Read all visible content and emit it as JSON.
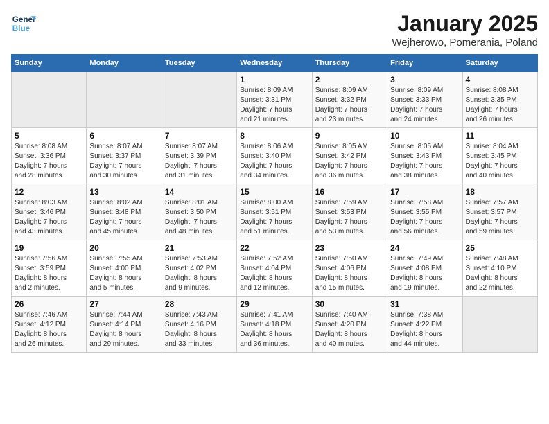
{
  "header": {
    "logo_line1": "General",
    "logo_line2": "Blue",
    "month": "January 2025",
    "location": "Wejherowo, Pomerania, Poland"
  },
  "weekdays": [
    "Sunday",
    "Monday",
    "Tuesday",
    "Wednesday",
    "Thursday",
    "Friday",
    "Saturday"
  ],
  "weeks": [
    [
      {
        "day": "",
        "info": ""
      },
      {
        "day": "",
        "info": ""
      },
      {
        "day": "",
        "info": ""
      },
      {
        "day": "1",
        "info": "Sunrise: 8:09 AM\nSunset: 3:31 PM\nDaylight: 7 hours\nand 21 minutes."
      },
      {
        "day": "2",
        "info": "Sunrise: 8:09 AM\nSunset: 3:32 PM\nDaylight: 7 hours\nand 23 minutes."
      },
      {
        "day": "3",
        "info": "Sunrise: 8:09 AM\nSunset: 3:33 PM\nDaylight: 7 hours\nand 24 minutes."
      },
      {
        "day": "4",
        "info": "Sunrise: 8:08 AM\nSunset: 3:35 PM\nDaylight: 7 hours\nand 26 minutes."
      }
    ],
    [
      {
        "day": "5",
        "info": "Sunrise: 8:08 AM\nSunset: 3:36 PM\nDaylight: 7 hours\nand 28 minutes."
      },
      {
        "day": "6",
        "info": "Sunrise: 8:07 AM\nSunset: 3:37 PM\nDaylight: 7 hours\nand 30 minutes."
      },
      {
        "day": "7",
        "info": "Sunrise: 8:07 AM\nSunset: 3:39 PM\nDaylight: 7 hours\nand 31 minutes."
      },
      {
        "day": "8",
        "info": "Sunrise: 8:06 AM\nSunset: 3:40 PM\nDaylight: 7 hours\nand 34 minutes."
      },
      {
        "day": "9",
        "info": "Sunrise: 8:05 AM\nSunset: 3:42 PM\nDaylight: 7 hours\nand 36 minutes."
      },
      {
        "day": "10",
        "info": "Sunrise: 8:05 AM\nSunset: 3:43 PM\nDaylight: 7 hours\nand 38 minutes."
      },
      {
        "day": "11",
        "info": "Sunrise: 8:04 AM\nSunset: 3:45 PM\nDaylight: 7 hours\nand 40 minutes."
      }
    ],
    [
      {
        "day": "12",
        "info": "Sunrise: 8:03 AM\nSunset: 3:46 PM\nDaylight: 7 hours\nand 43 minutes."
      },
      {
        "day": "13",
        "info": "Sunrise: 8:02 AM\nSunset: 3:48 PM\nDaylight: 7 hours\nand 45 minutes."
      },
      {
        "day": "14",
        "info": "Sunrise: 8:01 AM\nSunset: 3:50 PM\nDaylight: 7 hours\nand 48 minutes."
      },
      {
        "day": "15",
        "info": "Sunrise: 8:00 AM\nSunset: 3:51 PM\nDaylight: 7 hours\nand 51 minutes."
      },
      {
        "day": "16",
        "info": "Sunrise: 7:59 AM\nSunset: 3:53 PM\nDaylight: 7 hours\nand 53 minutes."
      },
      {
        "day": "17",
        "info": "Sunrise: 7:58 AM\nSunset: 3:55 PM\nDaylight: 7 hours\nand 56 minutes."
      },
      {
        "day": "18",
        "info": "Sunrise: 7:57 AM\nSunset: 3:57 PM\nDaylight: 7 hours\nand 59 minutes."
      }
    ],
    [
      {
        "day": "19",
        "info": "Sunrise: 7:56 AM\nSunset: 3:59 PM\nDaylight: 8 hours\nand 2 minutes."
      },
      {
        "day": "20",
        "info": "Sunrise: 7:55 AM\nSunset: 4:00 PM\nDaylight: 8 hours\nand 5 minutes."
      },
      {
        "day": "21",
        "info": "Sunrise: 7:53 AM\nSunset: 4:02 PM\nDaylight: 8 hours\nand 9 minutes."
      },
      {
        "day": "22",
        "info": "Sunrise: 7:52 AM\nSunset: 4:04 PM\nDaylight: 8 hours\nand 12 minutes."
      },
      {
        "day": "23",
        "info": "Sunrise: 7:50 AM\nSunset: 4:06 PM\nDaylight: 8 hours\nand 15 minutes."
      },
      {
        "day": "24",
        "info": "Sunrise: 7:49 AM\nSunset: 4:08 PM\nDaylight: 8 hours\nand 19 minutes."
      },
      {
        "day": "25",
        "info": "Sunrise: 7:48 AM\nSunset: 4:10 PM\nDaylight: 8 hours\nand 22 minutes."
      }
    ],
    [
      {
        "day": "26",
        "info": "Sunrise: 7:46 AM\nSunset: 4:12 PM\nDaylight: 8 hours\nand 26 minutes."
      },
      {
        "day": "27",
        "info": "Sunrise: 7:44 AM\nSunset: 4:14 PM\nDaylight: 8 hours\nand 29 minutes."
      },
      {
        "day": "28",
        "info": "Sunrise: 7:43 AM\nSunset: 4:16 PM\nDaylight: 8 hours\nand 33 minutes."
      },
      {
        "day": "29",
        "info": "Sunrise: 7:41 AM\nSunset: 4:18 PM\nDaylight: 8 hours\nand 36 minutes."
      },
      {
        "day": "30",
        "info": "Sunrise: 7:40 AM\nSunset: 4:20 PM\nDaylight: 8 hours\nand 40 minutes."
      },
      {
        "day": "31",
        "info": "Sunrise: 7:38 AM\nSunset: 4:22 PM\nDaylight: 8 hours\nand 44 minutes."
      },
      {
        "day": "",
        "info": ""
      }
    ]
  ]
}
